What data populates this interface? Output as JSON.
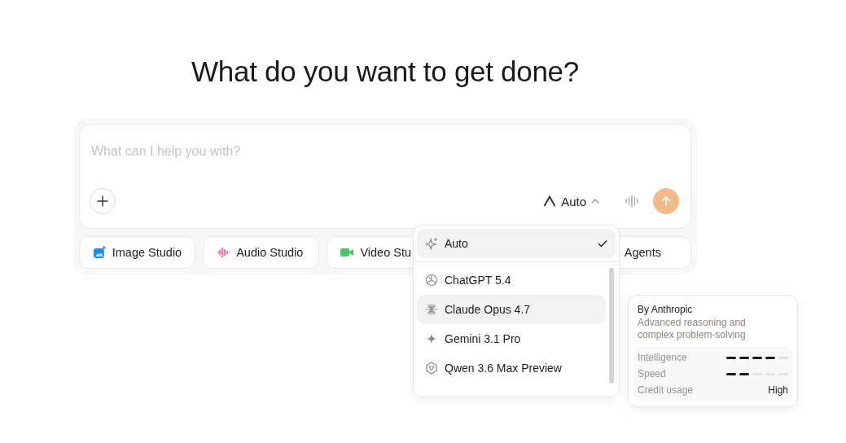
{
  "heading": "What do you want to get done?",
  "composer": {
    "placeholder": "What can I help you with?",
    "model_button": {
      "label": "Auto",
      "expanded": true
    }
  },
  "chips": [
    {
      "label": "Image Studio",
      "kind": "image"
    },
    {
      "label": "Audio Studio",
      "kind": "audio"
    },
    {
      "label": "Video Stu",
      "kind": "video"
    },
    {
      "label": "Agents",
      "kind": "agents"
    }
  ],
  "model_menu": {
    "items": [
      {
        "label": "Auto",
        "kind": "auto",
        "selected": true,
        "hovered": true
      },
      {
        "label": "ChatGPT 5.4",
        "kind": "chatgpt",
        "selected": false,
        "hovered": false
      },
      {
        "label": "Claude Opus 4.7",
        "kind": "claude",
        "selected": false,
        "hovered": true
      },
      {
        "label": "Gemini 3.1 Pro",
        "kind": "gemini",
        "selected": false,
        "hovered": false
      },
      {
        "label": "Qwen 3.6 Max Preview",
        "kind": "qwen",
        "selected": false,
        "hovered": false
      }
    ]
  },
  "model_info": {
    "title": "By Anthropic",
    "description": "Advanced reasoning and complex problem-solving",
    "stats": [
      {
        "label": "Intelligence",
        "kind": "meter",
        "level": 0.8
      },
      {
        "label": "Speed",
        "kind": "meter",
        "level": 0.4
      },
      {
        "label": "Credit usage",
        "kind": "text",
        "value": "High"
      }
    ]
  }
}
